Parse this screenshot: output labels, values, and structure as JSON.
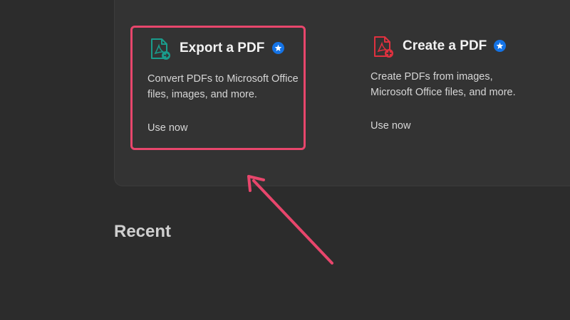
{
  "tools": [
    {
      "id": "export",
      "title": "Export a PDF",
      "description": "Convert PDFs to Microsoft Office files, images, and more.",
      "link": "Use now",
      "icon": "pdf-export-icon",
      "icon_color": "#1a9c8c",
      "highlighted": true
    },
    {
      "id": "create",
      "title": "Create a PDF",
      "description": "Create PDFs from images, Microsoft Office files, and more.",
      "link": "Use now",
      "icon": "pdf-create-icon",
      "icon_color": "#e0313f",
      "highlighted": false
    }
  ],
  "recent": {
    "heading": "Recent"
  },
  "colors": {
    "background": "#2c2c2c",
    "panel": "#333333",
    "highlight": "#e8466c",
    "badge": "#1473e6"
  }
}
